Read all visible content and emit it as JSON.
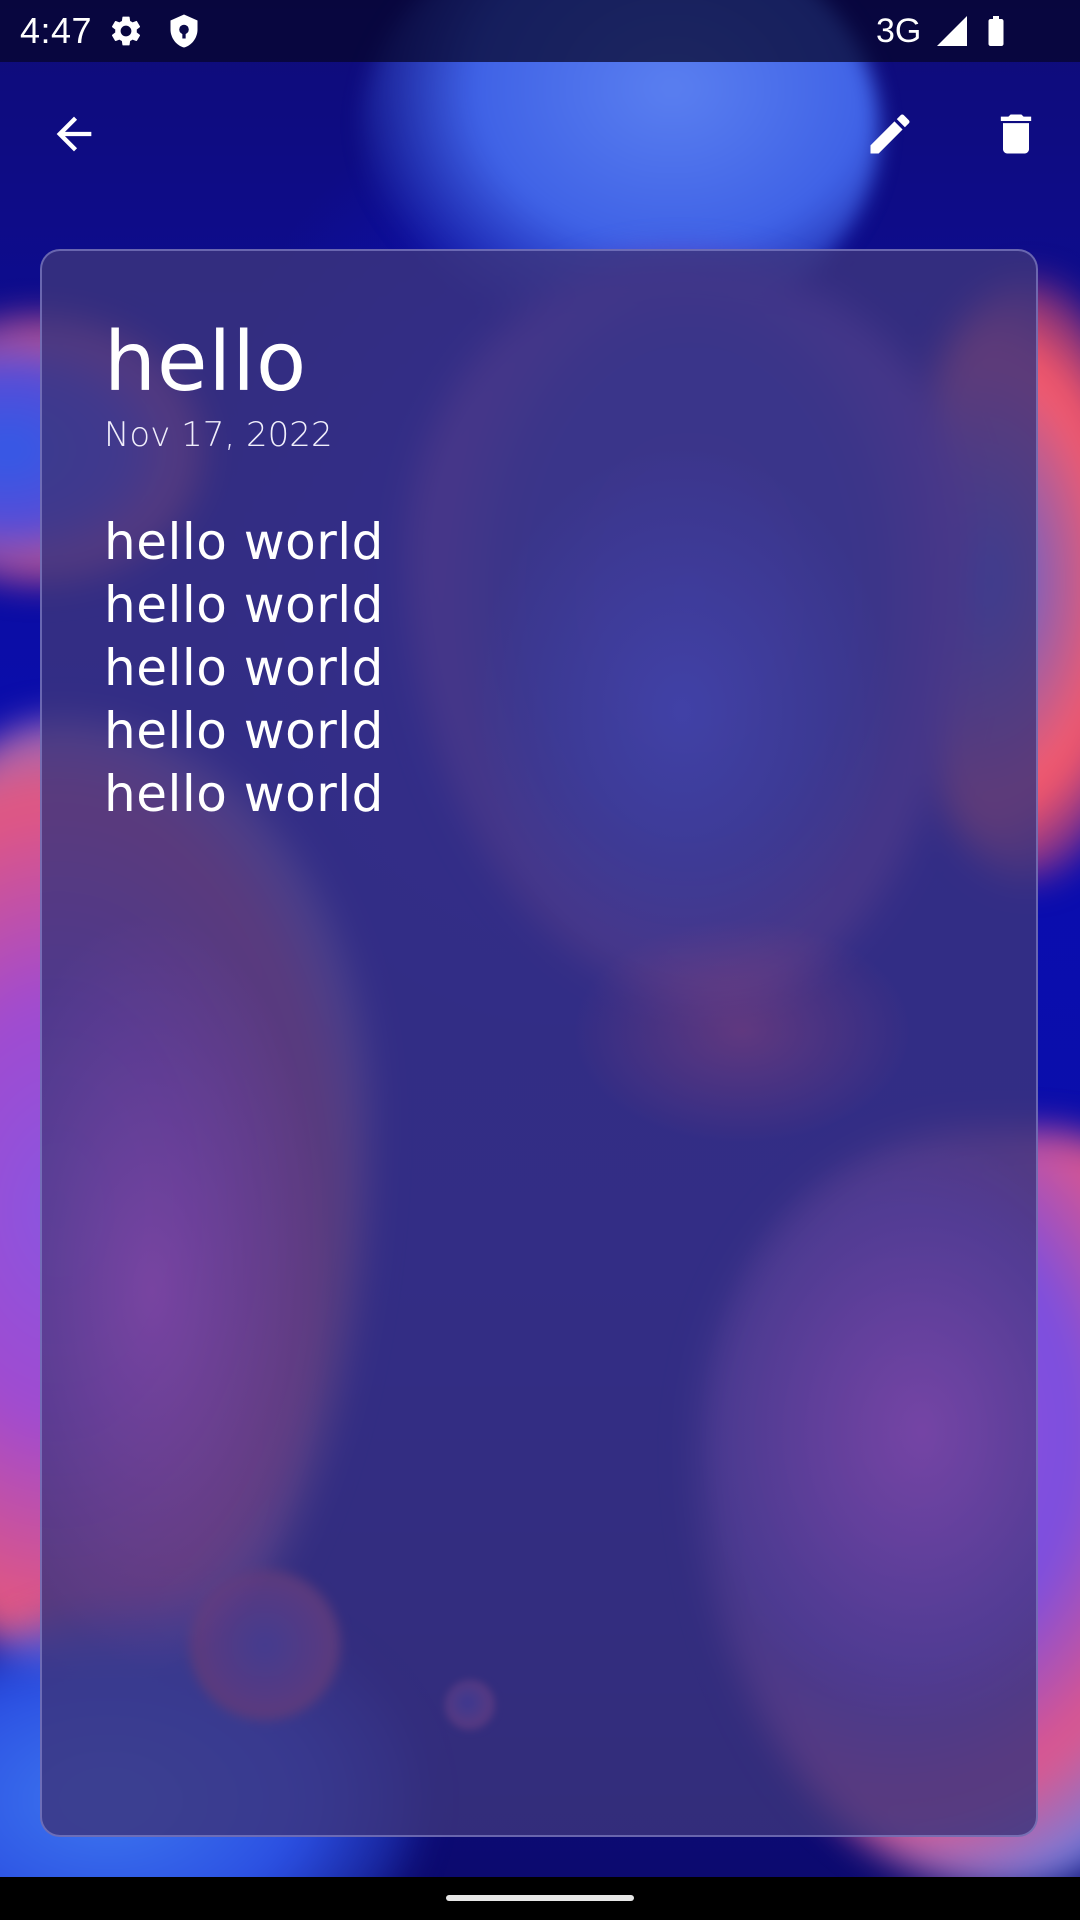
{
  "status_bar": {
    "time": "4:47",
    "icons": [
      "gear-icon",
      "shield-icon",
      "signal-icon",
      "battery-icon"
    ],
    "network": "3G"
  },
  "toolbar": {
    "back_icon": "arrow-left-icon",
    "edit_icon": "pencil-icon",
    "delete_icon": "trash-icon"
  },
  "note": {
    "title": "hello",
    "date": "Nov 17, 2022",
    "lines": [
      "hello world",
      "hello world",
      "hello world",
      "hello world",
      "hello world"
    ]
  },
  "colors": {
    "card_background": "#3c347d",
    "card_border": "#9696d7",
    "text": "#ffffff",
    "wallpaper_base": "#0a0db0"
  }
}
